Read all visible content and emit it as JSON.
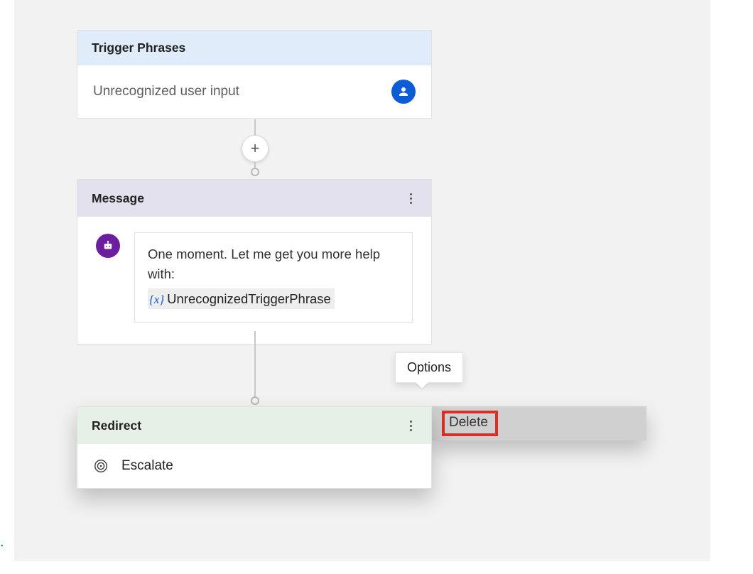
{
  "trigger": {
    "header": "Trigger Phrases",
    "text": "Unrecognized user input"
  },
  "message": {
    "header": "Message",
    "body_text": "One moment. Let me get you more help with:",
    "variable_prefix": "{x}",
    "variable_name": "UnrecognizedTriggerPhrase"
  },
  "redirect": {
    "header": "Redirect",
    "target": "Escalate"
  },
  "tooltip": {
    "options": "Options"
  },
  "menu": {
    "delete": "Delete"
  },
  "step": "."
}
